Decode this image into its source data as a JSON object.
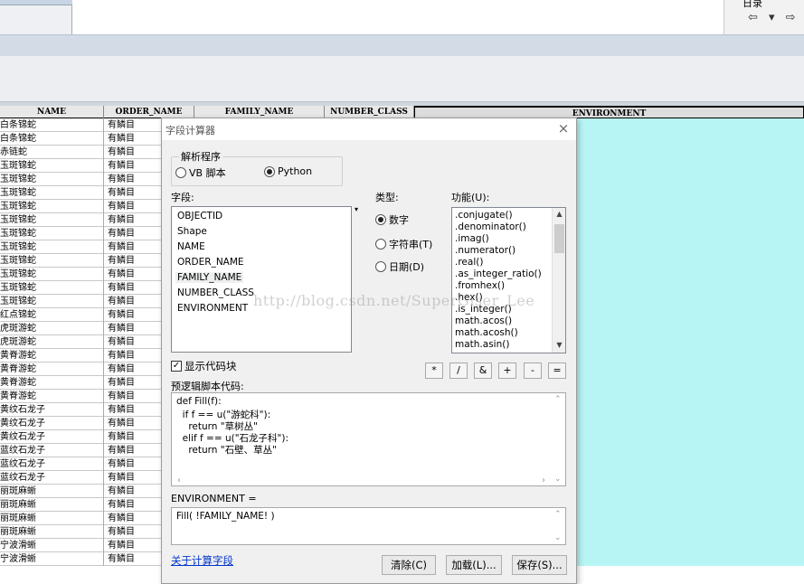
{
  "top": {
    "left_cell_text": "",
    "right_title": "日录",
    "nav_glyphs": "⇦ ▾ ⇨"
  },
  "table": {
    "headers": [
      "NAME",
      "ORDER_NAME",
      "FAMILY_NAME",
      "NUMBER_CLASS",
      "ENVIRONMENT"
    ],
    "rows": [
      [
        "白条锦蛇",
        "有鳞目"
      ],
      [
        "白条锦蛇",
        "有鳞目"
      ],
      [
        "赤链蛇",
        "有鳞目"
      ],
      [
        "玉斑锦蛇",
        "有鳞目"
      ],
      [
        "玉斑锦蛇",
        "有鳞目"
      ],
      [
        "玉斑锦蛇",
        "有鳞目"
      ],
      [
        "玉斑锦蛇",
        "有鳞目"
      ],
      [
        "玉斑锦蛇",
        "有鳞目"
      ],
      [
        "玉斑锦蛇",
        "有鳞目"
      ],
      [
        "玉斑锦蛇",
        "有鳞目"
      ],
      [
        "玉斑锦蛇",
        "有鳞目"
      ],
      [
        "玉斑锦蛇",
        "有鳞目"
      ],
      [
        "玉斑锦蛇",
        "有鳞目"
      ],
      [
        "玉斑锦蛇",
        "有鳞目"
      ],
      [
        "红点锦蛇",
        "有鳞目"
      ],
      [
        "虎斑游蛇",
        "有鳞目"
      ],
      [
        "虎斑游蛇",
        "有鳞目"
      ],
      [
        "黄脊游蛇",
        "有鳞目"
      ],
      [
        "黄脊游蛇",
        "有鳞目"
      ],
      [
        "黄脊游蛇",
        "有鳞目"
      ],
      [
        "黄脊游蛇",
        "有鳞目"
      ],
      [
        "黄纹石龙子",
        "有鳞目"
      ],
      [
        "黄纹石龙子",
        "有鳞目"
      ],
      [
        "黄纹石龙子",
        "有鳞目"
      ],
      [
        "蓝纹石龙子",
        "有鳞目"
      ],
      [
        "蓝纹石龙子",
        "有鳞目"
      ],
      [
        "蓝纹石龙子",
        "有鳞目"
      ],
      [
        "丽斑麻蜥",
        "有鳞目"
      ],
      [
        "丽斑麻蜥",
        "有鳞目"
      ],
      [
        "丽斑麻蜥",
        "有鳞目"
      ],
      [
        "丽斑麻蜥",
        "有鳞目"
      ],
      [
        "宁波滑蜥",
        "有鳞目"
      ],
      [
        "宁波滑蜥",
        "有鳞目"
      ]
    ]
  },
  "dialog": {
    "title": "字段计算器",
    "close": "×",
    "parser_label": "解析程序",
    "parser_vb": "VB 脚本",
    "parser_python": "Python",
    "fields_label": "字段:",
    "fields": [
      "OBJECTID",
      "Shape",
      "NAME",
      "ORDER_NAME",
      "FAMILY_NAME",
      "NUMBER_CLASS",
      "ENVIRONMENT"
    ],
    "type_label": "类型:",
    "type_number": "数字",
    "type_string": "字符串(T)",
    "type_date": "日期(D)",
    "functions_label": "功能(U):",
    "functions": [
      ".conjugate()",
      ".denominator()",
      ".imag()",
      ".numerator()",
      ".real()",
      ".as_integer_ratio()",
      ".fromhex()",
      ".hex()",
      ".is_integer()",
      "math.acos()",
      "math.acosh()",
      "math.asin()"
    ],
    "operators": [
      "*",
      "/",
      "&",
      "+",
      "-",
      "="
    ],
    "show_codeblock": "显示代码块",
    "codeblock_label": "预逻辑脚本代码:",
    "code_lines": [
      "def Fill(f):",
      "  if f == u(\"游蛇科\"):",
      "    return \"草树丛\"",
      "  elif f == u(\"石龙子科\"):",
      "    return \"石壁、草丛\""
    ],
    "expr_label": "ENVIRONMENT =",
    "expression": "Fill( !FAMILY_NAME! )",
    "about_link": "关于计算字段",
    "btn_clear": "清除(C)",
    "btn_load": "加载(L)...",
    "btn_save": "保存(S)..."
  },
  "watermark": "http://blog.csdn.net/SuperGiser_Lee",
  "colors": {
    "env_column": "#b7f5f5",
    "link": "#0033cc"
  }
}
